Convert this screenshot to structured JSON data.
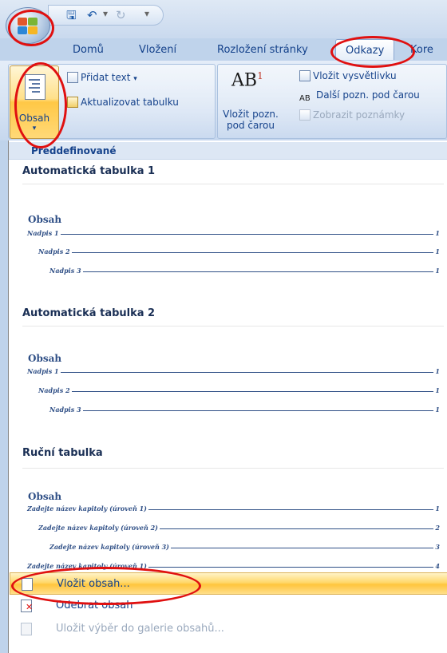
{
  "tabs": [
    "Domů",
    "Vložení",
    "Rozložení stránky",
    "Odkazy",
    "Kore"
  ],
  "active_tab": "Odkazy",
  "ribbon": {
    "obsah_label": "Obsah",
    "pridat_text": "Přidat text",
    "aktualizovat": "Aktualizovat tabulku",
    "vlozit_pozn_line1": "Vložit pozn.",
    "vlozit_pozn_line2": "pod čarou",
    "vlozit_vysvetlivku": "Vložit vysvětlivku",
    "dalsi_pozn": "Další pozn. pod čarou",
    "zobrazit_poznamky": "Zobrazit poznámky"
  },
  "gallery": {
    "header": "Předdefinované",
    "sections": [
      {
        "title": "Automatická tabulka 1",
        "preview_title": "Obsah",
        "lines": [
          {
            "text": "Nadpis 1",
            "page": "1",
            "level": 1
          },
          {
            "text": "Nadpis 2",
            "page": "1",
            "level": 2
          },
          {
            "text": "Nadpis 3",
            "page": "1",
            "level": 3
          }
        ]
      },
      {
        "title": "Automatická tabulka 2",
        "preview_title": "Obsah",
        "lines": [
          {
            "text": "Nadpis 1",
            "page": "1",
            "level": 1
          },
          {
            "text": "Nadpis 2",
            "page": "1",
            "level": 2
          },
          {
            "text": "Nadpis 3",
            "page": "1",
            "level": 3
          }
        ]
      },
      {
        "title": "Ruční tabulka",
        "preview_title": "Obsah",
        "lines": [
          {
            "text": "Zadejte název kapitoly (úroveň 1)",
            "page": "1",
            "level": 1
          },
          {
            "text": "Zadejte název kapitoly (úroveň 2)",
            "page": "2",
            "level": 2
          },
          {
            "text": "Zadejte název kapitoly (úroveň 3)",
            "page": "3",
            "level": 3
          },
          {
            "text": "Zadejte název kapitoly (úroveň 1)",
            "page": "4",
            "level": 1
          }
        ]
      }
    ]
  },
  "menu": {
    "insert_toc": "Vložit obsah...",
    "remove_toc": "Odebrat obsah",
    "save_selection": "Uložit výběr do galerie obsahů..."
  },
  "colors": {
    "accent": "#15428b",
    "highlight": "#ffd86b",
    "annotation": "#e01010"
  }
}
